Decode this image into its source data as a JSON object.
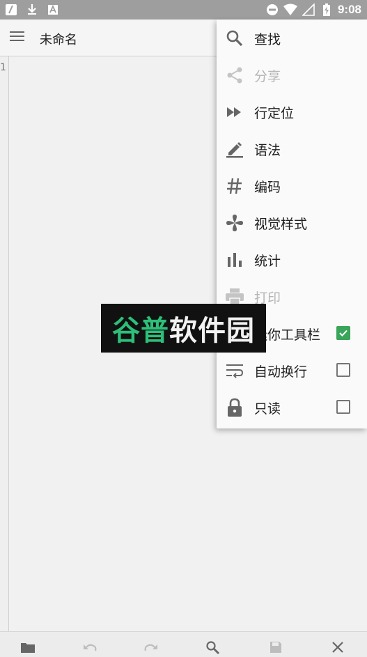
{
  "status_bar": {
    "time": "9:08"
  },
  "app": {
    "title": "未命名"
  },
  "editor": {
    "line_numbers": [
      "1"
    ]
  },
  "menu": {
    "items": [
      {
        "label": "查找",
        "icon": "search-icon",
        "enabled": true
      },
      {
        "label": "分享",
        "icon": "share-icon",
        "enabled": false
      },
      {
        "label": "行定位",
        "icon": "fast-forward-icon",
        "enabled": true
      },
      {
        "label": "语法",
        "icon": "pen-underline-icon",
        "enabled": true
      },
      {
        "label": "编码",
        "icon": "hash-icon",
        "enabled": true
      },
      {
        "label": "视觉样式",
        "icon": "pinwheel-icon",
        "enabled": true
      },
      {
        "label": "统计",
        "icon": "bar-chart-icon",
        "enabled": true
      },
      {
        "label": "打印",
        "icon": "printer-icon",
        "enabled": false
      },
      {
        "label": "迷你工具栏",
        "icon": "toolbar-icon",
        "enabled": true,
        "checkbox": true,
        "checked": true
      },
      {
        "label": "自动换行",
        "icon": "wrap-icon",
        "enabled": true,
        "checkbox": true,
        "checked": false
      },
      {
        "label": "只读",
        "icon": "lock-icon",
        "enabled": true,
        "checkbox": true,
        "checked": false
      }
    ]
  },
  "watermark": {
    "part1": "谷普",
    "part2": "软件园"
  },
  "colors": {
    "status_bar": "#9e9e9e",
    "checkbox_checked": "#3aa45a",
    "watermark_green": "#2dbf7a"
  }
}
